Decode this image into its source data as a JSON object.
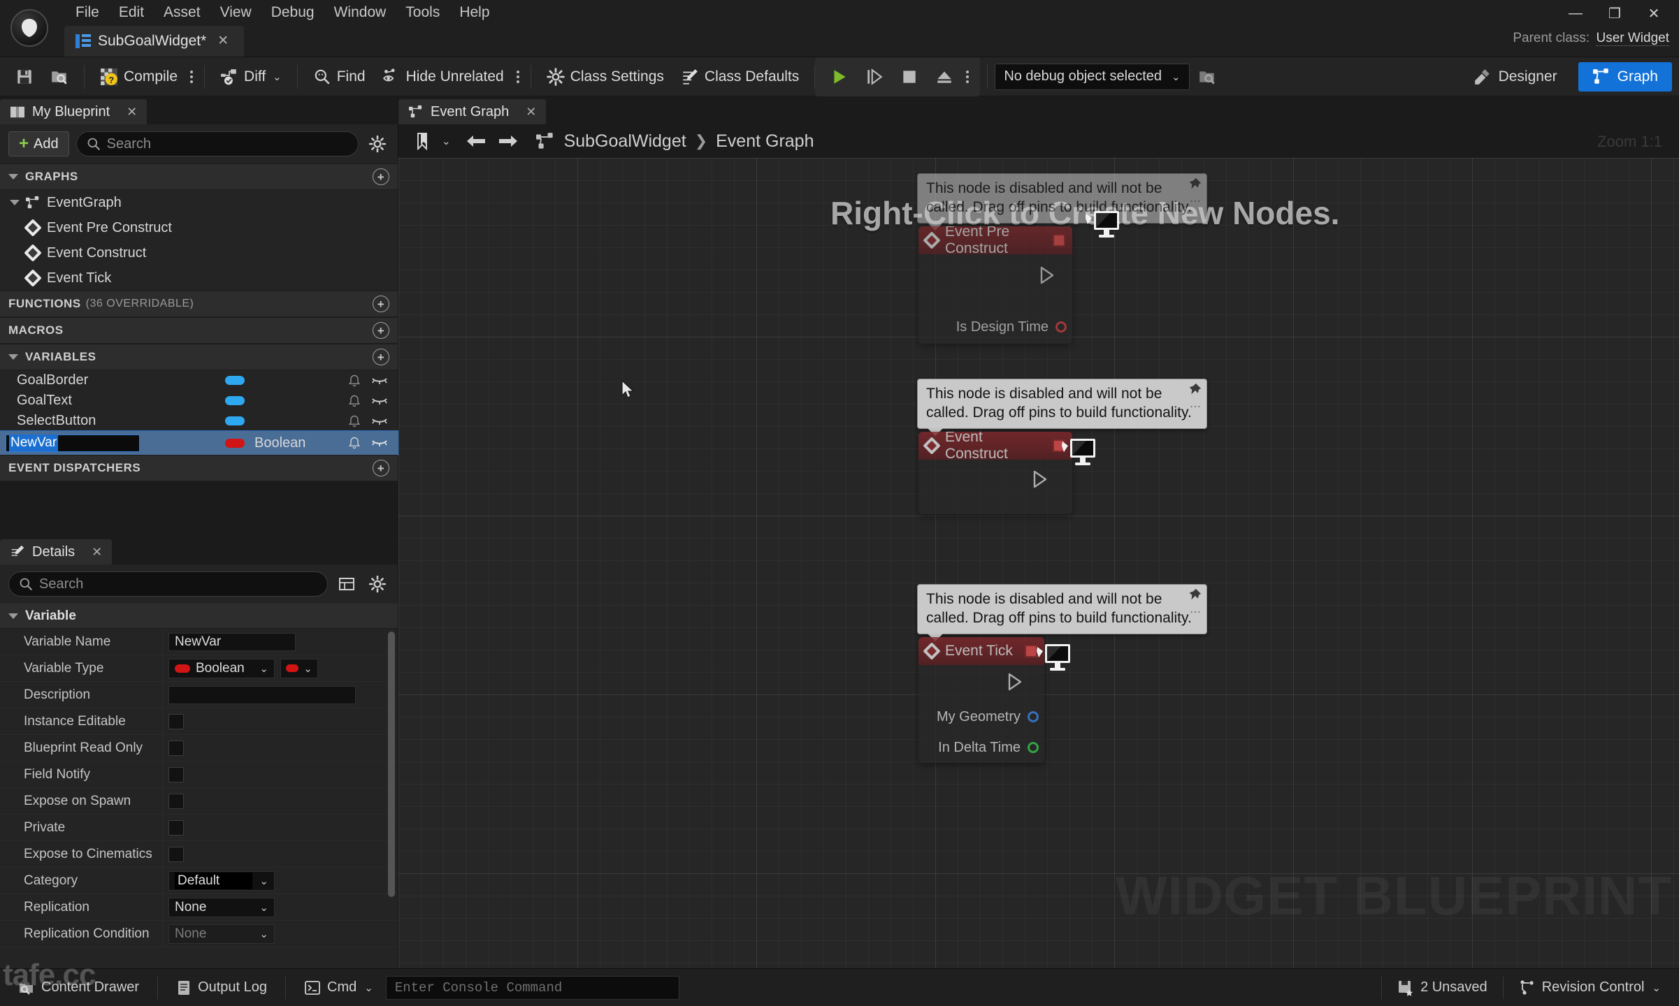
{
  "window": {
    "minimize_label": "—",
    "maximize_label": "❐",
    "close_label": "✕",
    "parent_class_label": "Parent class:",
    "parent_class_value": "User Widget"
  },
  "menubar": {
    "items": [
      "File",
      "Edit",
      "Asset",
      "View",
      "Debug",
      "Window",
      "Tools",
      "Help"
    ]
  },
  "asset_tab": {
    "title": "SubGoalWidget*",
    "close": "✕",
    "icon": "blueprint-icon"
  },
  "toolbar": {
    "save_icon": "save-icon",
    "browse_icon": "browse-to-asset-icon",
    "compile_label": "Compile",
    "compile_icon": "compile-status-unknown-icon",
    "diff_label": "Diff",
    "find_label": "Find",
    "hide_unrelated_label": "Hide Unrelated",
    "class_settings_label": "Class Settings",
    "class_defaults_label": "Class Defaults",
    "play_icon": "play-icon",
    "step_icon": "step-icon",
    "stop_icon": "stop-icon",
    "eject_icon": "eject-icon",
    "debug_object_value": "No debug object selected",
    "designer_label": "Designer",
    "graph_label": "Graph"
  },
  "my_blueprint": {
    "tab_title": "My Blueprint",
    "tab_close": "✕",
    "add_label": "Add",
    "search_placeholder": "Search",
    "settings_icon": "gear-icon",
    "sections": {
      "graphs": {
        "label": "GRAPHS",
        "add": "+"
      },
      "functions": {
        "label": "FUNCTIONS",
        "sub": "(36 OVERRIDABLE)",
        "add": "+"
      },
      "macros": {
        "label": "MACROS",
        "add": "+"
      },
      "variables": {
        "label": "VARIABLES",
        "add": "+"
      },
      "event_dispatchers": {
        "label": "EVENT DISPATCHERS",
        "add": "+"
      }
    },
    "event_graph_item": "EventGraph",
    "events": [
      "Event Pre Construct",
      "Event Construct",
      "Event Tick"
    ],
    "variables": [
      {
        "name": "GoalBorder",
        "type": "",
        "pill": "object",
        "editing": false
      },
      {
        "name": "GoalText",
        "type": "",
        "pill": "object",
        "editing": false
      },
      {
        "name": "SelectButton",
        "type": "",
        "pill": "object",
        "editing": false
      },
      {
        "name": "NewVar",
        "type": "Boolean",
        "pill": "bool",
        "editing": true
      }
    ]
  },
  "details": {
    "tab_title": "Details",
    "tab_close": "✕",
    "search_placeholder": "Search",
    "section_label": "Variable",
    "rows": [
      {
        "label": "Variable Name",
        "kind": "text",
        "value": "NewVar"
      },
      {
        "label": "Variable Type",
        "kind": "type",
        "value": "Boolean"
      },
      {
        "label": "Description",
        "kind": "textwide",
        "value": ""
      },
      {
        "label": "Instance Editable",
        "kind": "checkbox",
        "value": ""
      },
      {
        "label": "Blueprint Read Only",
        "kind": "checkbox",
        "value": ""
      },
      {
        "label": "Field Notify",
        "kind": "checkbox",
        "value": ""
      },
      {
        "label": "Expose on Spawn",
        "kind": "checkbox",
        "value": ""
      },
      {
        "label": "Private",
        "kind": "checkbox",
        "value": ""
      },
      {
        "label": "Expose to Cinematics",
        "kind": "checkbox",
        "value": ""
      },
      {
        "label": "Category",
        "kind": "combo_inset",
        "value": "Default"
      },
      {
        "label": "Replication",
        "kind": "combo",
        "value": "None"
      },
      {
        "label": "Replication Condition",
        "kind": "combo_disabled",
        "value": "None"
      }
    ]
  },
  "graph": {
    "tab_title": "Event Graph",
    "tab_close": "✕",
    "breadcrumb": [
      "SubGoalWidget",
      "Event Graph"
    ],
    "breadcrumb_sep": "❯",
    "zoom_label": "Zoom 1:1",
    "watermark": "WIDGET BLUEPRINT",
    "hint": "Right-Click to Create New Nodes.",
    "bookmark_icon": "bookmark-icon",
    "back_icon": "arrow-left-icon",
    "forward_icon": "arrow-right-icon",
    "nodes": [
      {
        "title": "Event Pre Construct",
        "tooltip": "This node is disabled and will not be called. Drag off pins to build functionality.",
        "pins": [
          {
            "label": "Is Design Time",
            "color": "red"
          }
        ]
      },
      {
        "title": "Event Construct",
        "tooltip": "This node is disabled and will not be called. Drag off pins to build functionality.",
        "pins": []
      },
      {
        "title": "Event Tick",
        "tooltip": "This node is disabled and will not be called. Drag off pins to build functionality.",
        "pins": [
          {
            "label": "My Geometry",
            "color": "blue"
          },
          {
            "label": "In Delta Time",
            "color": "green"
          }
        ]
      }
    ]
  },
  "statusbar": {
    "content_drawer_label": "Content Drawer",
    "output_log_label": "Output Log",
    "cmd_label": "Cmd",
    "console_placeholder": "Enter Console Command",
    "unsaved_label": "2 Unsaved",
    "revision_control_label": "Revision Control",
    "watermark": "tafe.cc"
  },
  "colors": {
    "accent_blue": "#1272d8",
    "bool_red": "#d11414",
    "object_blue": "#2ea8f0",
    "play_green": "#7dbb2a",
    "selection_blue": "#4a6d96"
  }
}
